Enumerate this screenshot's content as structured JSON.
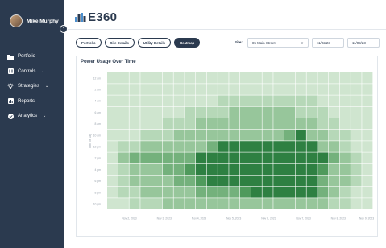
{
  "user": {
    "name": "Mike Murphy"
  },
  "brand": {
    "logo_text": "E360",
    "accent": "#2b3a4f"
  },
  "nav": [
    {
      "label": "Portfolio",
      "icon": "folder-icon",
      "has_menu": false
    },
    {
      "label": "Controls",
      "icon": "controls-icon",
      "has_menu": true
    },
    {
      "label": "Strategies",
      "icon": "lightbulb-icon",
      "has_menu": true
    },
    {
      "label": "Reports",
      "icon": "reports-icon",
      "has_menu": false
    },
    {
      "label": "Analytics",
      "icon": "analytics-icon",
      "has_menu": true
    }
  ],
  "filters": {
    "tabs": [
      {
        "label": "Portfolio",
        "active": false
      },
      {
        "label": "Site Details",
        "active": false
      },
      {
        "label": "Utility Details",
        "active": false
      },
      {
        "label": "Heatmap",
        "active": true
      }
    ],
    "site_label": "Site:",
    "site_value": "85 Main Street",
    "date_start": "11/02/23",
    "date_end": "11/09/23"
  },
  "chart_data": {
    "type": "heatmap",
    "title": "Power Usage Over Time",
    "ylabel": "Time of Day",
    "xlabel": "",
    "y_ticks": [
      "12 am",
      "2 am",
      "4 am",
      "6 am",
      "8 am",
      "10 am",
      "12 pm",
      "2 pm",
      "4 pm",
      "6 pm",
      "8 pm",
      "10 pm"
    ],
    "x_ticks": [
      "Nov 2, 2023",
      "Nov 3, 2023",
      "Nov 4, 2023",
      "Nov 5, 2023",
      "Nov 6, 2023",
      "Nov 7, 2023",
      "Nov 8, 2023",
      "Nov 9, 2023"
    ],
    "columns": 24,
    "rows": 12,
    "legend": "none",
    "grid": false,
    "colors": [
      "#e6f1e6",
      "#cfe5cf",
      "#b6d8b8",
      "#97c69b",
      "#74b17c",
      "#4f9a5c",
      "#2e8042"
    ],
    "values": [
      [
        1,
        1,
        1,
        1,
        1,
        1,
        1,
        1,
        1,
        1,
        1,
        1,
        1,
        1,
        1,
        1,
        1,
        1,
        1,
        1,
        1,
        1,
        1,
        1
      ],
      [
        1,
        1,
        1,
        1,
        1,
        1,
        1,
        1,
        1,
        1,
        1,
        1,
        1,
        1,
        1,
        1,
        1,
        1,
        1,
        1,
        1,
        1,
        1,
        1
      ],
      [
        1,
        1,
        1,
        1,
        1,
        1,
        1,
        1,
        1,
        1,
        2,
        2,
        2,
        2,
        2,
        2,
        2,
        2,
        2,
        1,
        1,
        1,
        1,
        1
      ],
      [
        1,
        1,
        1,
        1,
        1,
        1,
        1,
        2,
        2,
        2,
        2,
        3,
        3,
        3,
        3,
        3,
        3,
        2,
        2,
        2,
        1,
        1,
        1,
        1
      ],
      [
        1,
        1,
        1,
        1,
        1,
        2,
        2,
        2,
        3,
        3,
        3,
        3,
        3,
        3,
        3,
        3,
        3,
        3,
        3,
        2,
        2,
        1,
        1,
        1
      ],
      [
        1,
        1,
        1,
        2,
        2,
        2,
        3,
        3,
        3,
        3,
        3,
        3,
        3,
        3,
        3,
        3,
        4,
        6,
        3,
        3,
        2,
        2,
        1,
        1
      ],
      [
        1,
        2,
        2,
        3,
        3,
        3,
        3,
        3,
        3,
        4,
        6,
        6,
        6,
        6,
        6,
        6,
        6,
        6,
        6,
        3,
        3,
        2,
        1,
        1
      ],
      [
        1,
        3,
        4,
        4,
        4,
        4,
        4,
        4,
        6,
        6,
        6,
        6,
        6,
        6,
        6,
        6,
        6,
        6,
        6,
        6,
        4,
        3,
        2,
        1
      ],
      [
        1,
        2,
        3,
        3,
        3,
        4,
        4,
        5,
        6,
        6,
        6,
        6,
        6,
        6,
        6,
        6,
        6,
        6,
        6,
        5,
        3,
        3,
        2,
        1
      ],
      [
        1,
        2,
        3,
        3,
        3,
        3,
        4,
        4,
        5,
        6,
        6,
        6,
        6,
        6,
        6,
        6,
        6,
        6,
        6,
        4,
        3,
        3,
        2,
        1
      ],
      [
        1,
        2,
        2,
        3,
        3,
        3,
        3,
        3,
        4,
        4,
        4,
        4,
        5,
        6,
        6,
        6,
        6,
        6,
        6,
        4,
        3,
        2,
        1,
        1
      ],
      [
        1,
        1,
        2,
        2,
        2,
        3,
        3,
        3,
        3,
        3,
        3,
        3,
        3,
        3,
        3,
        3,
        3,
        3,
        3,
        3,
        2,
        2,
        1,
        1
      ]
    ]
  }
}
